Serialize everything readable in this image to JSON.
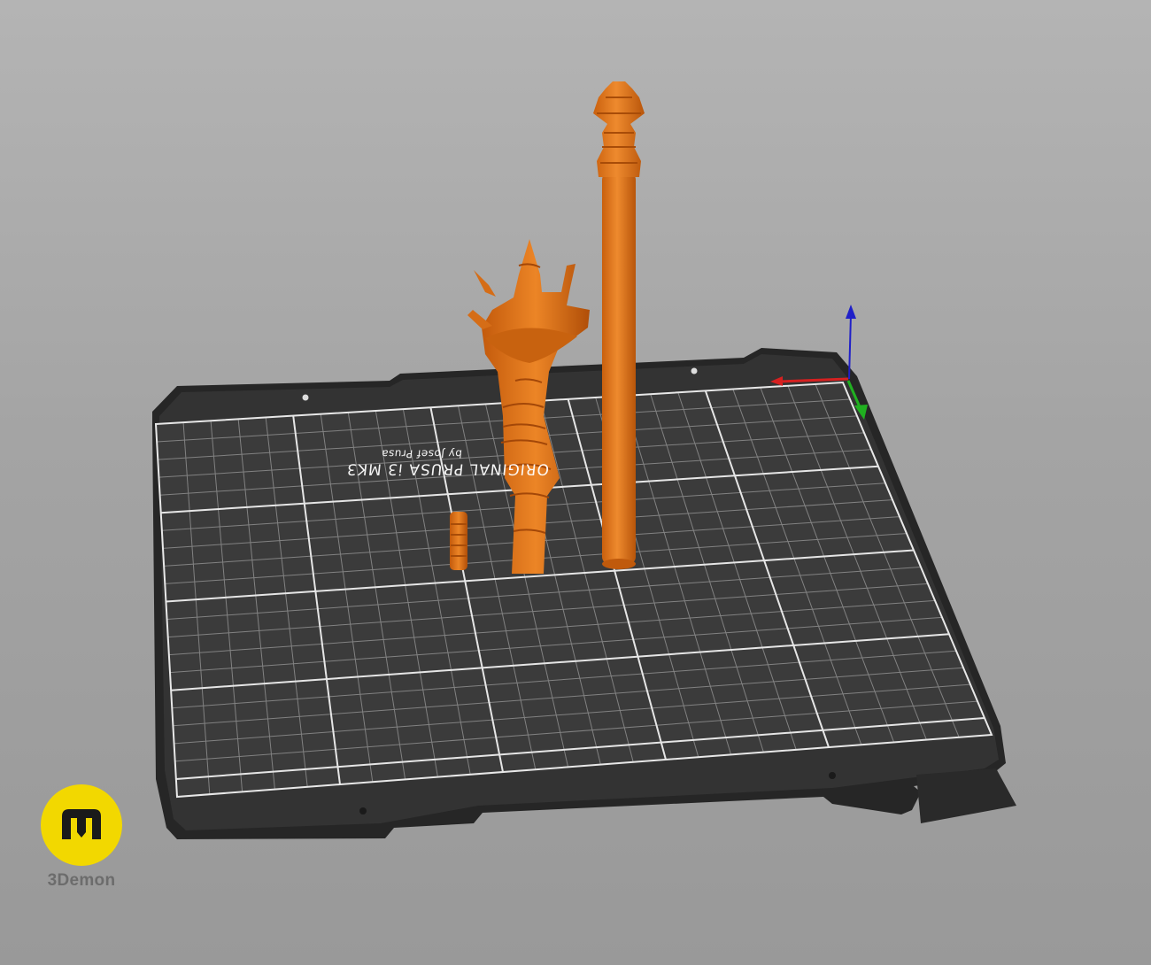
{
  "scene": {
    "background": "#aaaaaa",
    "bed_color": "#2e2e2e",
    "model_color": "#e2761b",
    "axis_colors": {
      "x": "#d62020",
      "y": "#20b020",
      "z": "#2020c8"
    }
  },
  "bed": {
    "label_line1": "ORIGINAL PRUSA i3 MK3",
    "label_line2": "by Josef Prusa"
  },
  "objects": [
    {
      "name": "mace-head",
      "icon": "mace-head-icon"
    },
    {
      "name": "staff",
      "icon": "staff-icon"
    },
    {
      "name": "small-piece",
      "icon": "small-piece-icon"
    }
  ],
  "brand": {
    "name": "3Demon",
    "badge_color": "#f2d800",
    "mark_color": "#1a1a1a"
  }
}
